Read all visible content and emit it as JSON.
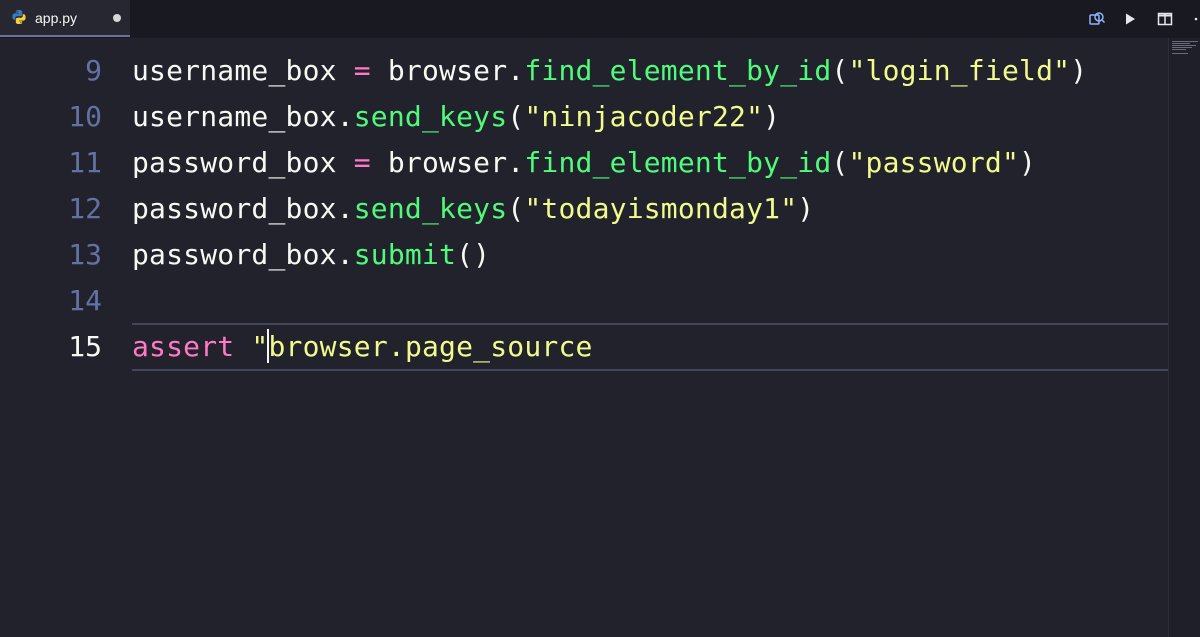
{
  "tabs": [
    {
      "label": "app.py",
      "icon": "python-icon",
      "modified": true
    }
  ],
  "toolbar": {
    "actions": [
      {
        "name": "compare-icon",
        "glyph": "⧉"
      },
      {
        "name": "run-icon",
        "glyph": "▶"
      },
      {
        "name": "split-editor-icon",
        "glyph": "◫"
      },
      {
        "name": "more-icon",
        "glyph": "⋯"
      }
    ]
  },
  "editor": {
    "active_line": 15,
    "lines": [
      {
        "number": "9",
        "tokens": [
          {
            "t": "username_box ",
            "c": "plain"
          },
          {
            "t": "=",
            "c": "op"
          },
          {
            "t": " browser.",
            "c": "plain"
          },
          {
            "t": "find_element_by_id",
            "c": "fn"
          },
          {
            "t": "(",
            "c": "plain"
          },
          {
            "t": "\"login_field\"",
            "c": "str"
          },
          {
            "t": ")",
            "c": "plain"
          }
        ]
      },
      {
        "number": "10",
        "tokens": [
          {
            "t": "username_box.",
            "c": "plain"
          },
          {
            "t": "send_keys",
            "c": "fn"
          },
          {
            "t": "(",
            "c": "plain"
          },
          {
            "t": "\"ninjacoder22\"",
            "c": "str"
          },
          {
            "t": ")",
            "c": "plain"
          }
        ]
      },
      {
        "number": "11",
        "tokens": [
          {
            "t": "password_box ",
            "c": "plain"
          },
          {
            "t": "=",
            "c": "op"
          },
          {
            "t": " browser.",
            "c": "plain"
          },
          {
            "t": "find_element_by_id",
            "c": "fn"
          },
          {
            "t": "(",
            "c": "plain"
          },
          {
            "t": "\"password\"",
            "c": "str"
          },
          {
            "t": ")",
            "c": "plain"
          }
        ]
      },
      {
        "number": "12",
        "tokens": [
          {
            "t": "password_box.",
            "c": "plain"
          },
          {
            "t": "send_keys",
            "c": "fn"
          },
          {
            "t": "(",
            "c": "plain"
          },
          {
            "t": "\"todayismonday1\"",
            "c": "str"
          },
          {
            "t": ")",
            "c": "plain"
          }
        ]
      },
      {
        "number": "13",
        "tokens": [
          {
            "t": "password_box.",
            "c": "plain"
          },
          {
            "t": "submit",
            "c": "fn"
          },
          {
            "t": "()",
            "c": "plain"
          }
        ]
      },
      {
        "number": "14",
        "tokens": []
      },
      {
        "number": "15",
        "tokens": [
          {
            "t": "assert",
            "c": "kw"
          },
          {
            "t": " \"",
            "c": "str"
          },
          {
            "t": "|CURSOR|",
            "c": "cursor"
          },
          {
            "t": "browser.page_source",
            "c": "str"
          }
        ]
      }
    ]
  },
  "colors": {
    "background": "#21222c",
    "plain": "#f8f8f2",
    "operator": "#ff79c6",
    "function": "#50fa7b",
    "string": "#f1fa8c",
    "line_number": "#6272a4"
  }
}
